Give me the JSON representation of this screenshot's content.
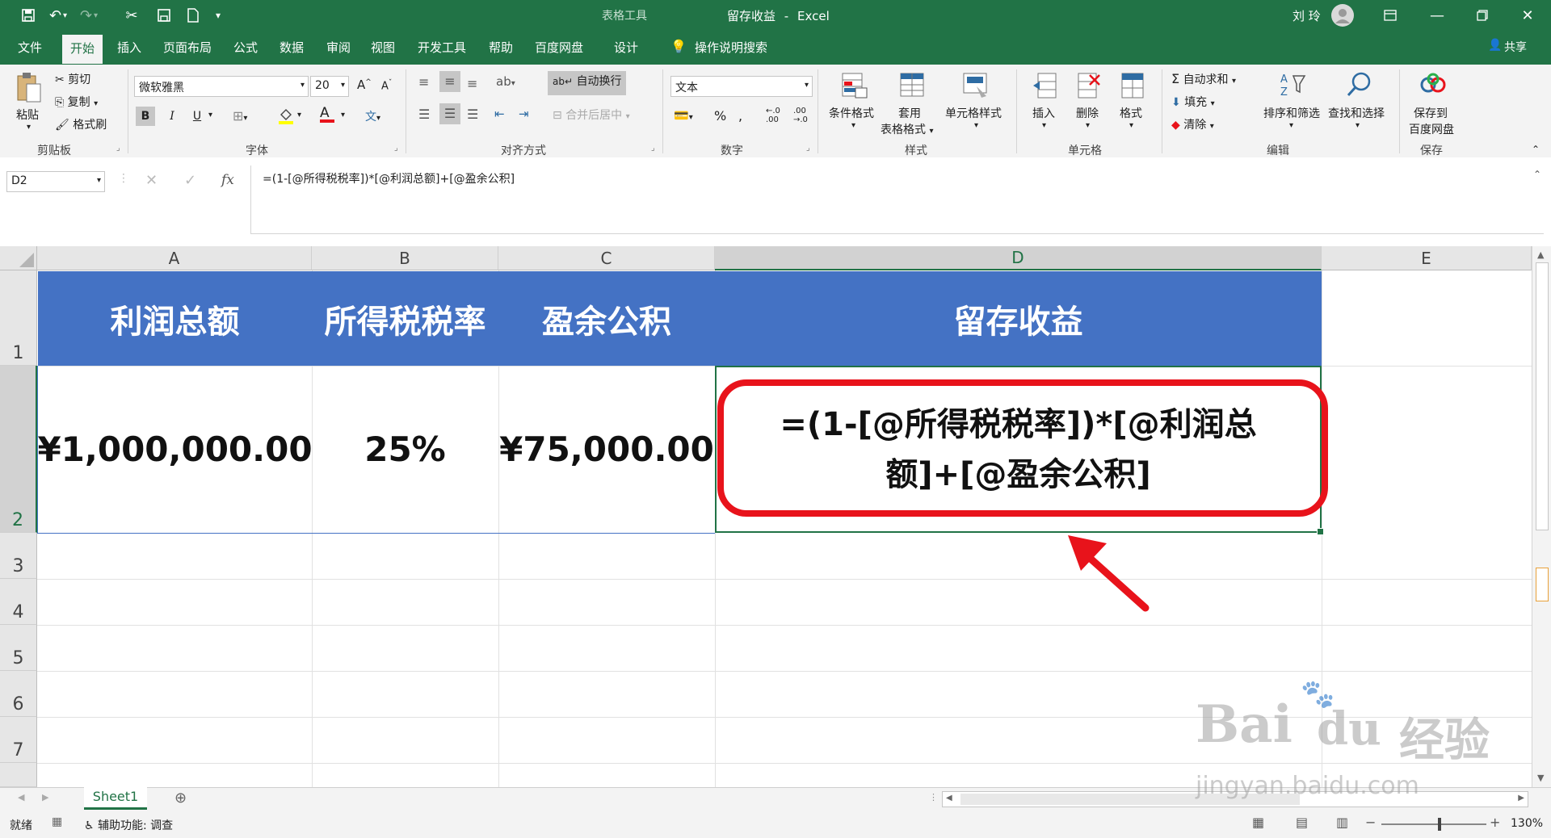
{
  "window": {
    "doc_title": "留存收益",
    "app_name": "Excel",
    "title_separator": "-",
    "context_tool": "表格工具",
    "user_name": "刘 玲"
  },
  "ribbon_tabs": [
    "文件",
    "开始",
    "插入",
    "页面布局",
    "公式",
    "数据",
    "审阅",
    "视图",
    "开发工具",
    "帮助",
    "百度网盘",
    "设计"
  ],
  "tell_me": "操作说明搜索",
  "share_label": "共享",
  "clipboard": {
    "paste": "粘贴",
    "cut": "剪切",
    "copy": "复制",
    "format_painter": "格式刷",
    "group": "剪贴板"
  },
  "font": {
    "name": "微软雅黑",
    "size": "20",
    "bold": "B",
    "italic": "I",
    "underline": "U",
    "group": "字体"
  },
  "alignment": {
    "wrap": "自动换行",
    "merge": "合并后居中",
    "group": "对齐方式"
  },
  "number": {
    "format": "文本",
    "percent": "%",
    "group": "数字"
  },
  "styles": {
    "conditional": "条件格式",
    "table_format_1": "套用",
    "table_format_2": "表格格式",
    "cell_styles": "单元格样式",
    "group": "样式"
  },
  "cells": {
    "insert": "插入",
    "delete": "删除",
    "format": "格式",
    "group": "单元格"
  },
  "editing": {
    "autosum": "自动求和",
    "fill": "填充",
    "clear": "清除",
    "sort": "排序和筛选",
    "find": "查找和选择",
    "group": "编辑"
  },
  "save_group": {
    "line1": "保存到",
    "line2": "百度网盘",
    "group": "保存"
  },
  "formula_bar": {
    "name_box": "D2",
    "fx": "fx",
    "formula": "=(1-[@所得税税率])*[@利润总额]+[@盈余公积]"
  },
  "columns": [
    "A",
    "B",
    "C",
    "D",
    "E"
  ],
  "rows": [
    "1",
    "2",
    "3",
    "4",
    "5",
    "6",
    "7"
  ],
  "table": {
    "headers": [
      "利润总额",
      "所得税税率",
      "盈余公积",
      "留存收益"
    ],
    "values": [
      "¥1,000,000.00",
      "25%",
      "¥75,000.00"
    ],
    "d2_line1": "=(1-[@所得税税率])*[@利润总",
    "d2_line2": "额]+[@盈余公积]"
  },
  "sheet_tab": "Sheet1",
  "status": {
    "ready": "就绪",
    "accessibility": "辅助功能: 调查",
    "zoom": "130%"
  },
  "colors": {
    "excel_green": "#217346",
    "table_header": "#4472c4",
    "annotation_red": "#e8131b"
  },
  "watermark": {
    "line1": "Bai",
    "line2": "du",
    "cn": "经验",
    "url": "jingyan.baidu.com"
  }
}
